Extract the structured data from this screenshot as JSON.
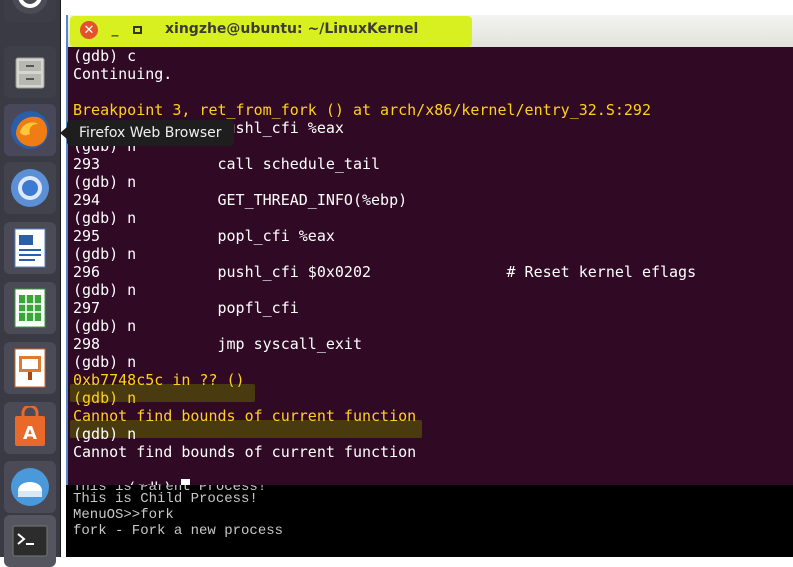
{
  "window": {
    "title": "xingzhe@ubuntu: ~/LinuxKernel"
  },
  "launcher": {
    "tooltip": "Firefox Web Browser",
    "items": [
      {
        "name": "ubuntu-dash",
        "icon": "ubuntu-logo-icon"
      },
      {
        "name": "files",
        "icon": "file-cabinet-icon"
      },
      {
        "name": "firefox",
        "icon": "firefox-icon"
      },
      {
        "name": "chromium",
        "icon": "chromium-icon"
      },
      {
        "name": "writer",
        "icon": "writer-icon"
      },
      {
        "name": "calc",
        "icon": "calc-icon"
      },
      {
        "name": "impress",
        "icon": "impress-icon"
      },
      {
        "name": "software-center",
        "icon": "software-center-icon"
      },
      {
        "name": "update-manager",
        "icon": "update-manager-icon"
      },
      {
        "name": "terminal",
        "icon": "terminal-icon"
      }
    ]
  },
  "terminal": {
    "lines": [
      "(gdb) c",
      "Continuing.",
      "",
      "Breakpoint 3, ret_from_fork () at arch/x86/kernel/entry_32.S:292",
      "292             pushl_cfi %eax",
      "(gdb) n",
      "293             call schedule_tail",
      "(gdb) n",
      "294             GET_THREAD_INFO(%ebp)",
      "(gdb) n",
      "295             popl_cfi %eax",
      "(gdb) n",
      "296             pushl_cfi $0x0202               # Reset kernel eflags",
      "(gdb) n",
      "297             popfl_cfi",
      "(gdb) n",
      "298             jmp syscall_exit",
      "(gdb) n",
      "0xb7748c5c in ?? ()",
      "(gdb) n",
      "Cannot find bounds of current function",
      "(gdb) n",
      "Cannot find bounds of current function",
      "(gdb) "
    ]
  },
  "qemu": {
    "lines": [
      "This is Parent Process!",
      "This is Child Process!",
      "MenuOS>>fork",
      "fork - Fork a new process"
    ]
  },
  "colors": {
    "terminal_bg": "#300a24",
    "terminal_fg": "#ffffff",
    "highlight_text": "#ffd21a",
    "title_highlight": "#d9f020",
    "launcher_bg": "#3a3a45"
  }
}
